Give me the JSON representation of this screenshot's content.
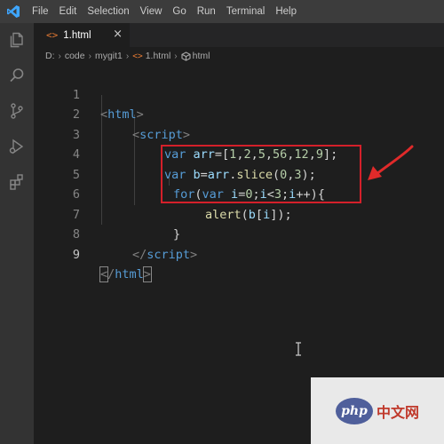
{
  "titlebar": {
    "menu": [
      "File",
      "Edit",
      "Selection",
      "View",
      "Go",
      "Run",
      "Terminal",
      "Help"
    ]
  },
  "activity_bar": {
    "icons": [
      "explorer-icon",
      "search-icon",
      "source-control-icon",
      "run-debug-icon",
      "extensions-icon"
    ]
  },
  "tab": {
    "file_icon": "<>",
    "label": "1.html",
    "close_glyph": "×"
  },
  "breadcrumb": {
    "items": [
      "D:",
      "code",
      "mygit1"
    ],
    "file_icon": "<>",
    "file": "1.html",
    "symbol": "html"
  },
  "editor": {
    "line_numbers": [
      "1",
      "2",
      "3",
      "4",
      "5",
      "6",
      "7",
      "8",
      "9"
    ],
    "current_line": "9",
    "lines": [
      [
        {
          "t": "<",
          "c": "t-br"
        },
        {
          "t": "html",
          "c": "t-tag"
        },
        {
          "t": ">",
          "c": "t-br"
        }
      ],
      [
        {
          "t": "<",
          "c": "t-br"
        },
        {
          "t": "script",
          "c": "t-tag"
        },
        {
          "t": ">",
          "c": "t-br"
        }
      ],
      [
        {
          "t": "var ",
          "c": "t-kw"
        },
        {
          "t": "arr",
          "c": "t-var"
        },
        {
          "t": "=[",
          "c": "t-plain"
        },
        {
          "t": "1",
          "c": "t-num"
        },
        {
          "t": ",",
          "c": "t-plain"
        },
        {
          "t": "2",
          "c": "t-num"
        },
        {
          "t": ",",
          "c": "t-plain"
        },
        {
          "t": "5",
          "c": "t-num"
        },
        {
          "t": ",",
          "c": "t-plain"
        },
        {
          "t": "56",
          "c": "t-num"
        },
        {
          "t": ",",
          "c": "t-plain"
        },
        {
          "t": "12",
          "c": "t-num"
        },
        {
          "t": ",",
          "c": "t-plain"
        },
        {
          "t": "9",
          "c": "t-num"
        },
        {
          "t": "];",
          "c": "t-plain"
        }
      ],
      [
        {
          "t": "var ",
          "c": "t-kw"
        },
        {
          "t": "b",
          "c": "t-var"
        },
        {
          "t": "=",
          "c": "t-plain"
        },
        {
          "t": "arr",
          "c": "t-var"
        },
        {
          "t": ".",
          "c": "t-plain"
        },
        {
          "t": "slice",
          "c": "t-fn"
        },
        {
          "t": "(",
          "c": "t-plain"
        },
        {
          "t": "0",
          "c": "t-num"
        },
        {
          "t": ",",
          "c": "t-plain"
        },
        {
          "t": "3",
          "c": "t-num"
        },
        {
          "t": ");",
          "c": "t-plain"
        }
      ],
      [
        {
          "t": "for",
          "c": "t-kw"
        },
        {
          "t": "(",
          "c": "t-plain"
        },
        {
          "t": "var ",
          "c": "t-kw"
        },
        {
          "t": "i",
          "c": "t-var"
        },
        {
          "t": "=",
          "c": "t-plain"
        },
        {
          "t": "0",
          "c": "t-num"
        },
        {
          "t": ";",
          "c": "t-plain"
        },
        {
          "t": "i",
          "c": "t-var"
        },
        {
          "t": "<",
          "c": "t-plain"
        },
        {
          "t": "3",
          "c": "t-num"
        },
        {
          "t": ";",
          "c": "t-plain"
        },
        {
          "t": "i",
          "c": "t-var"
        },
        {
          "t": "++){",
          "c": "t-plain"
        }
      ],
      [
        {
          "t": "alert",
          "c": "t-fn"
        },
        {
          "t": "(",
          "c": "t-plain"
        },
        {
          "t": "b",
          "c": "t-var"
        },
        {
          "t": "[",
          "c": "t-plain"
        },
        {
          "t": "i",
          "c": "t-var"
        },
        {
          "t": "]);",
          "c": "t-plain"
        }
      ],
      [
        {
          "t": "}",
          "c": "t-plain"
        }
      ],
      [
        {
          "t": "</",
          "c": "t-br"
        },
        {
          "t": "script",
          "c": "t-tag"
        },
        {
          "t": ">",
          "c": "t-br"
        }
      ],
      [
        {
          "t": "<",
          "c": "t-br bracket-box"
        },
        {
          "t": "/",
          "c": "t-br"
        },
        {
          "t": "html",
          "c": "t-tag"
        },
        {
          "t": ">",
          "c": "t-br bracket-box"
        }
      ]
    ]
  },
  "annotation": {
    "box_color": "#d4202a",
    "arrow_color": "#e02a2a"
  },
  "watermark": {
    "logo": "php",
    "text": "中文网"
  }
}
